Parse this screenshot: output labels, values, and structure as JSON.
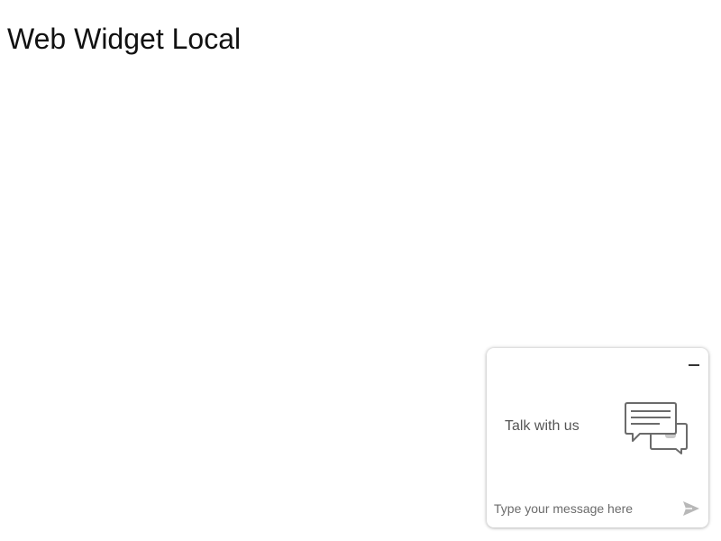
{
  "page": {
    "title": "Web Widget Local"
  },
  "chat_widget": {
    "greeting": "Talk with us",
    "input": {
      "value": "",
      "placeholder": "Type your message here"
    },
    "icons": {
      "minimize": "minimize-icon",
      "illustration": "chat-bubbles-icon",
      "send": "send-icon"
    },
    "colors": {
      "icon_stroke": "#6b6b6b",
      "send_icon": "#b8b8b8"
    }
  }
}
